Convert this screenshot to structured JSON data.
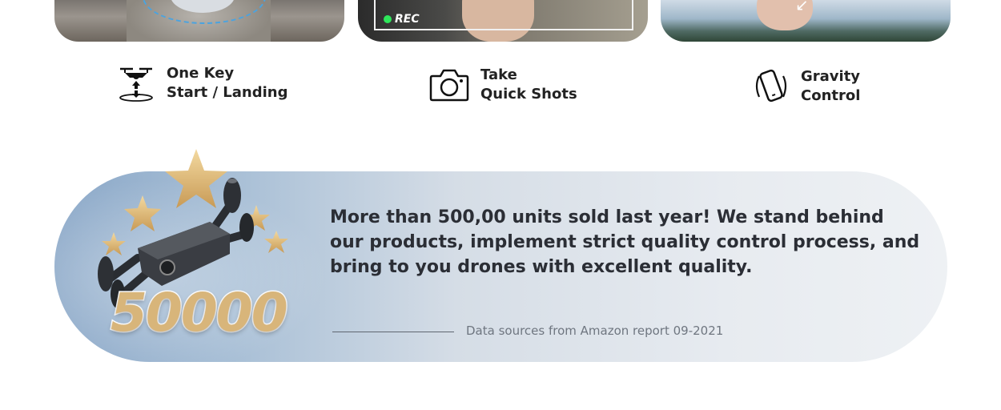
{
  "cards": {
    "rec_label": "REC"
  },
  "features": [
    {
      "icon": "drone-landing-icon",
      "line1": "One Key",
      "line2": "Start / Landing"
    },
    {
      "icon": "camera-icon",
      "line1": "Take",
      "line2": "Quick Shots"
    },
    {
      "icon": "gravity-phone-icon",
      "line1": "Gravity",
      "line2": "Control"
    }
  ],
  "banner": {
    "big_number": "50000",
    "text": "More than 500,00 units sold last year! We stand behind our products, implement strict quality control process, and bring to you drones with excellent quality.",
    "source": "Data sources from Amazon report  09-2021"
  },
  "colors": {
    "gold": "#d8b57a",
    "rec_dot": "#2ee65a",
    "landing_ring": "#4aa3e0"
  }
}
